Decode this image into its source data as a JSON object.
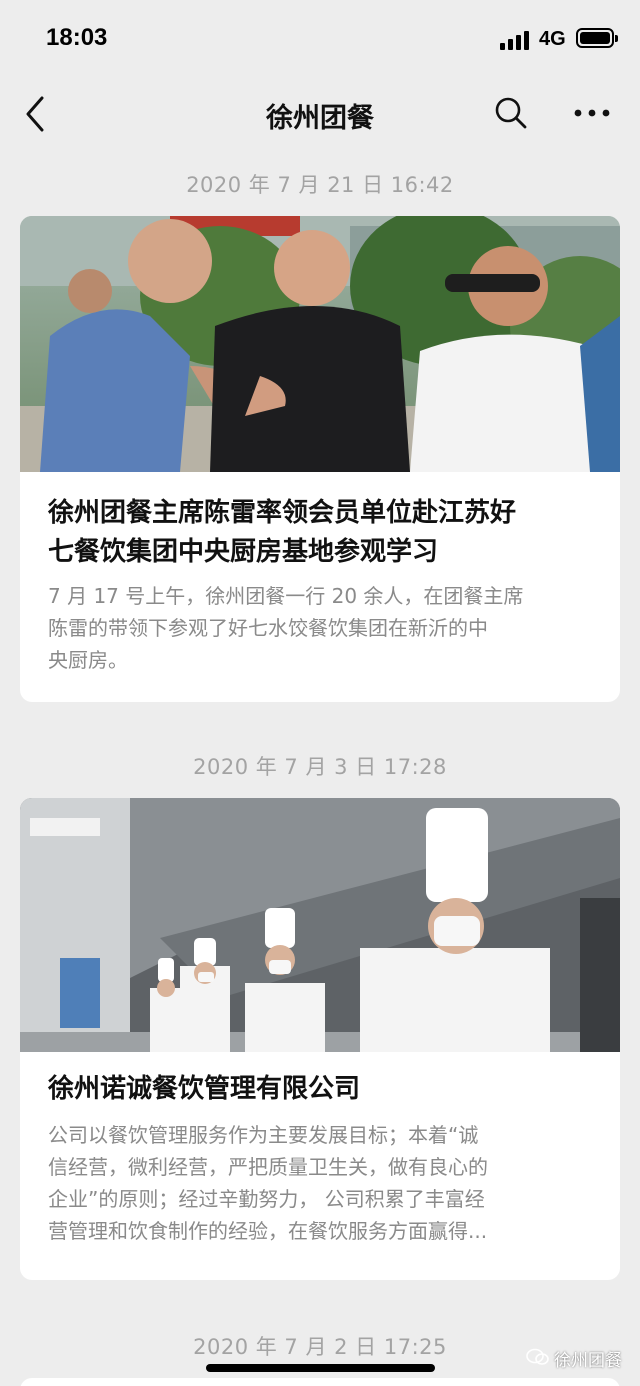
{
  "status_bar": {
    "time": "18:03",
    "network": "4G"
  },
  "nav": {
    "title": "徐州团餐"
  },
  "feed": [
    {
      "date": "2020 年 7 月 21 日 16:42",
      "title_line1": "徐州团餐主席陈雷率领会员单位赴江苏好",
      "title_line2": "七餐饮集团中央厨房基地参观学习",
      "desc_line1": "7 月 17 号上午，徐州团餐一行 20 余人，在团餐主席",
      "desc_line2": "陈雷的带领下参观了好七水饺餐饮集团在新沂的中",
      "desc_line3": "央厨房。"
    },
    {
      "date": "2020 年 7 月 3 日 17:28",
      "title_line1": "徐州诺诚餐饮管理有限公司",
      "desc_line1": "公司以餐饮管理服务作为主要发展目标；本着“诚",
      "desc_line2": "信经营，微利经营，严把质量卫生关，做有良心的",
      "desc_line3": "企业”的原则；经过辛勤努力， 公司积累了丰富经",
      "desc_line4": "营管理和饮食制作的经验，在餐饮服务方面赢得..."
    },
    {
      "date": "2020 年 7 月 2 日 17:25"
    }
  ],
  "watermark": "徐州团餐",
  "icons": {
    "back": "chevron-left-icon",
    "search": "search-icon",
    "more": "more-dots-icon",
    "signal": "signal-icon",
    "battery": "battery-icon"
  }
}
